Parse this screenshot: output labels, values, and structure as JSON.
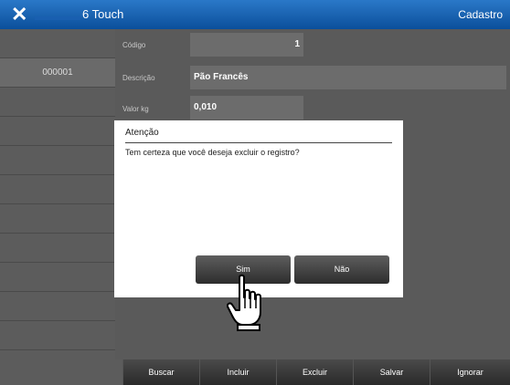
{
  "topbar": {
    "app_title": "6 Touch",
    "mode_title": "Cadastro",
    "close_icon": "close-icon"
  },
  "sidebar": {
    "rows": [
      "",
      "000001",
      "",
      "",
      "",
      "",
      "",
      "",
      "",
      "",
      "",
      ""
    ]
  },
  "form": {
    "fields": [
      {
        "label": "Código",
        "value": "1"
      },
      {
        "label": "Descrição",
        "value": "Pão Francês"
      },
      {
        "label": "Valor kg",
        "value": "0,010"
      }
    ]
  },
  "dialog": {
    "title": "Atenção",
    "message": "Tem certeza que você deseja excluir o registro?",
    "yes_label": "Sim",
    "no_label": "Não"
  },
  "footer": {
    "buttons": [
      "Buscar",
      "Incluir",
      "Excluir",
      "Salvar",
      "Ignorar"
    ]
  },
  "colors": {
    "accent": "#1a63b4",
    "dialog_button": "#3a3a3a",
    "background": "#5a5a5a"
  },
  "icons": {
    "pointer": "hand-pointer-icon"
  }
}
